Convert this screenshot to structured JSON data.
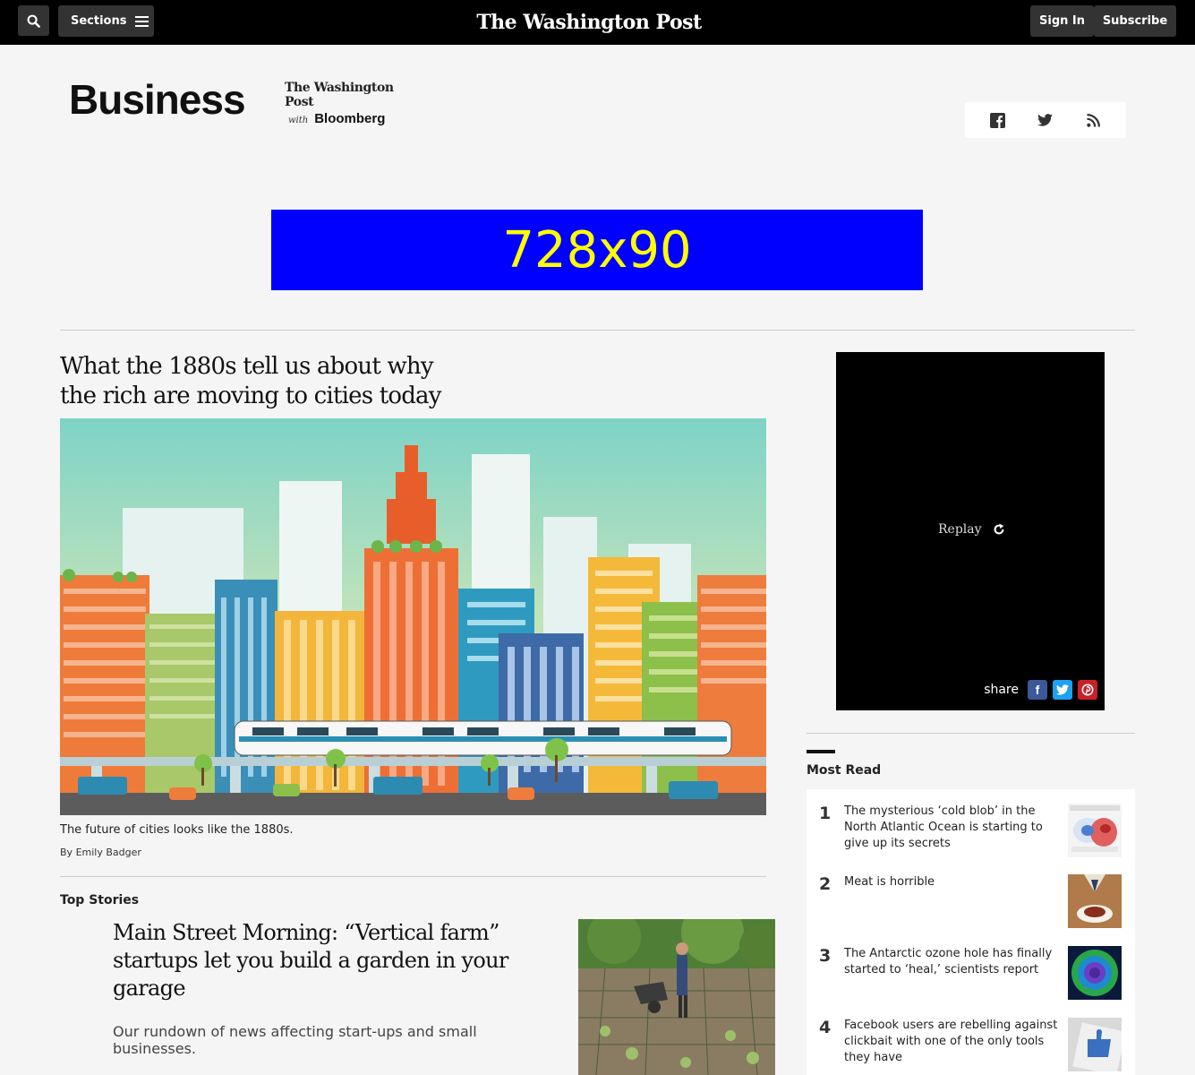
{
  "nav": {
    "sections_label": "Sections",
    "masthead": "The Washington Post",
    "signin_label": "Sign In",
    "subscribe_label": "Subscribe"
  },
  "section": {
    "title": "Business",
    "partner_wapo": "The Washington Post",
    "partner_with": "with",
    "partner_name": "Bloomberg",
    "social": [
      "facebook-icon",
      "twitter-icon",
      "rss-icon"
    ]
  },
  "ad": {
    "label": "728x90",
    "background": "#0000ff",
    "color": "#ffff00"
  },
  "lead": {
    "headline": "What the 1880s tell us about why the rich are moving to cities today",
    "caption": "The future of cities looks like the 1880s.",
    "byline_prefix": "By",
    "author": "Emily Badger"
  },
  "top_stories": {
    "label": "Top Stories",
    "headline": "Main Street Morning: “Vertical farm” startups let you build a garden in your garage",
    "blurb": "Our rundown of news affecting start-ups and small businesses."
  },
  "video": {
    "replay_label": "Replay",
    "share_label": "share",
    "share_colors": {
      "facebook": "#3b5998",
      "twitter": "#1da1f2",
      "pinterest": "#cb2027"
    }
  },
  "most_read": {
    "title": "Most Read",
    "items": [
      {
        "num": "1",
        "text": "The mysterious ‘cold blob’ in the North Atlantic Ocean is starting to give up its secrets"
      },
      {
        "num": "2",
        "text": "Meat is horrible"
      },
      {
        "num": "3",
        "text": "The Antarctic ozone hole has finally started to ‘heal,’ scientists report"
      },
      {
        "num": "4",
        "text": "Facebook users are rebelling against clickbait with one of the only tools they have"
      }
    ]
  }
}
